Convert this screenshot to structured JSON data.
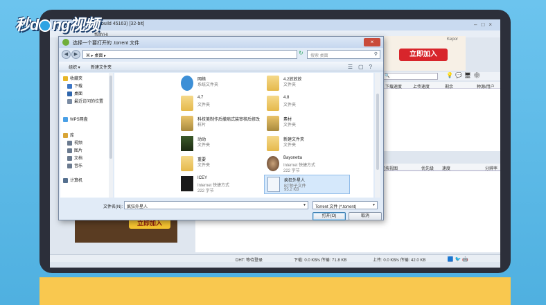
{
  "watermark": {
    "text_left": "秒",
    "text_right": "视频",
    "mid": "d",
    "mid2": "ng"
  },
  "app": {
    "title": "eta (build 45163) [32-bit]",
    "menu": "帮助(H)",
    "ad_label": "Kepor",
    "ad_button": "立即加入",
    "ad_button_bottom": "立即加入",
    "columns_top": [
      "下载速度",
      "上传速度",
      "剩余",
      "种源/用户"
    ],
    "columns_bottom": [
      "区块视图",
      "优先级",
      "速度",
      "分辨率"
    ],
    "status": {
      "dht": "DHT: 等待登录",
      "down": "下载: 0.0 KB/s 传输: 71.8 KB",
      "up": "上传: 0.0 KB/s 传输: 42.0 KB"
    }
  },
  "dialog": {
    "title": "选择一个要打开的 .torrent 文件",
    "address": "桌面",
    "search_placeholder": "搜索 桌面",
    "cmd_organize": "组织 ▾",
    "cmd_new_folder": "新建文件夹",
    "nav": [
      {
        "label": "收藏夹",
        "icon": "star-icon",
        "color": "#e8b628"
      },
      {
        "label": "下载",
        "icon": "download-icon",
        "color": "#3d76c5"
      },
      {
        "label": "桌面",
        "icon": "desktop-icon",
        "color": "#2f66ad"
      },
      {
        "label": "最近访问的位置",
        "icon": "recent-icon",
        "color": "#7a8ba3"
      },
      {
        "label": "WPS网盘",
        "icon": "cloud-icon",
        "color": "#4aa0e6"
      },
      {
        "label": "库",
        "icon": "library-icon",
        "color": "#d9a536"
      },
      {
        "label": "视频",
        "icon": "video-icon",
        "color": "#6a7a8f"
      },
      {
        "label": "图片",
        "icon": "picture-icon",
        "color": "#6a7a8f"
      },
      {
        "label": "文档",
        "icon": "document-icon",
        "color": "#6a7a8f"
      },
      {
        "label": "音乐",
        "icon": "music-icon",
        "color": "#6a7a8f"
      },
      {
        "label": "计算机",
        "icon": "computer-icon",
        "color": "#55708f"
      }
    ],
    "files": [
      {
        "name": "网络",
        "sub": "系统文件夹",
        "sub2": "",
        "kind": "network"
      },
      {
        "name": "4.2放放放",
        "sub": "文件夹",
        "sub2": "",
        "kind": "folder"
      },
      {
        "name": "4.7",
        "sub": "文件夹",
        "sub2": "",
        "kind": "folder"
      },
      {
        "name": "4.8",
        "sub": "文件夹",
        "sub2": "",
        "kind": "folder"
      },
      {
        "name": "科技美制作后撤病式装审核后修改",
        "sub": "样片",
        "sub2": "",
        "kind": "folder-img"
      },
      {
        "name": "素材",
        "sub": "文件夹",
        "sub2": "",
        "kind": "folder-img"
      },
      {
        "name": "动动",
        "sub": "文件夹",
        "sub2": "",
        "kind": "folder-dark"
      },
      {
        "name": "新建文件夹",
        "sub": "文件夹",
        "sub2": "",
        "kind": "folder"
      },
      {
        "name": "重要",
        "sub": "文件夹",
        "sub2": "",
        "kind": "folder"
      },
      {
        "name": "Bayonetta",
        "sub": "Internet 快捷方式",
        "sub2": "222 字节",
        "kind": "shortcut-round"
      },
      {
        "name": "ICEY",
        "sub": "Internet 快捷方式",
        "sub2": "222 字节",
        "kind": "shortcut-dark"
      },
      {
        "name": "疯狂外星人",
        "sub": "BT种子文件",
        "sub2": "95.2 KB",
        "kind": "torrent"
      }
    ],
    "filename_label": "文件名(N):",
    "filename_value": "疯狂外星人",
    "filetype": "Torrent 文件 (*.torrent)",
    "open_button": "打开(O)",
    "cancel_button": "取消"
  }
}
